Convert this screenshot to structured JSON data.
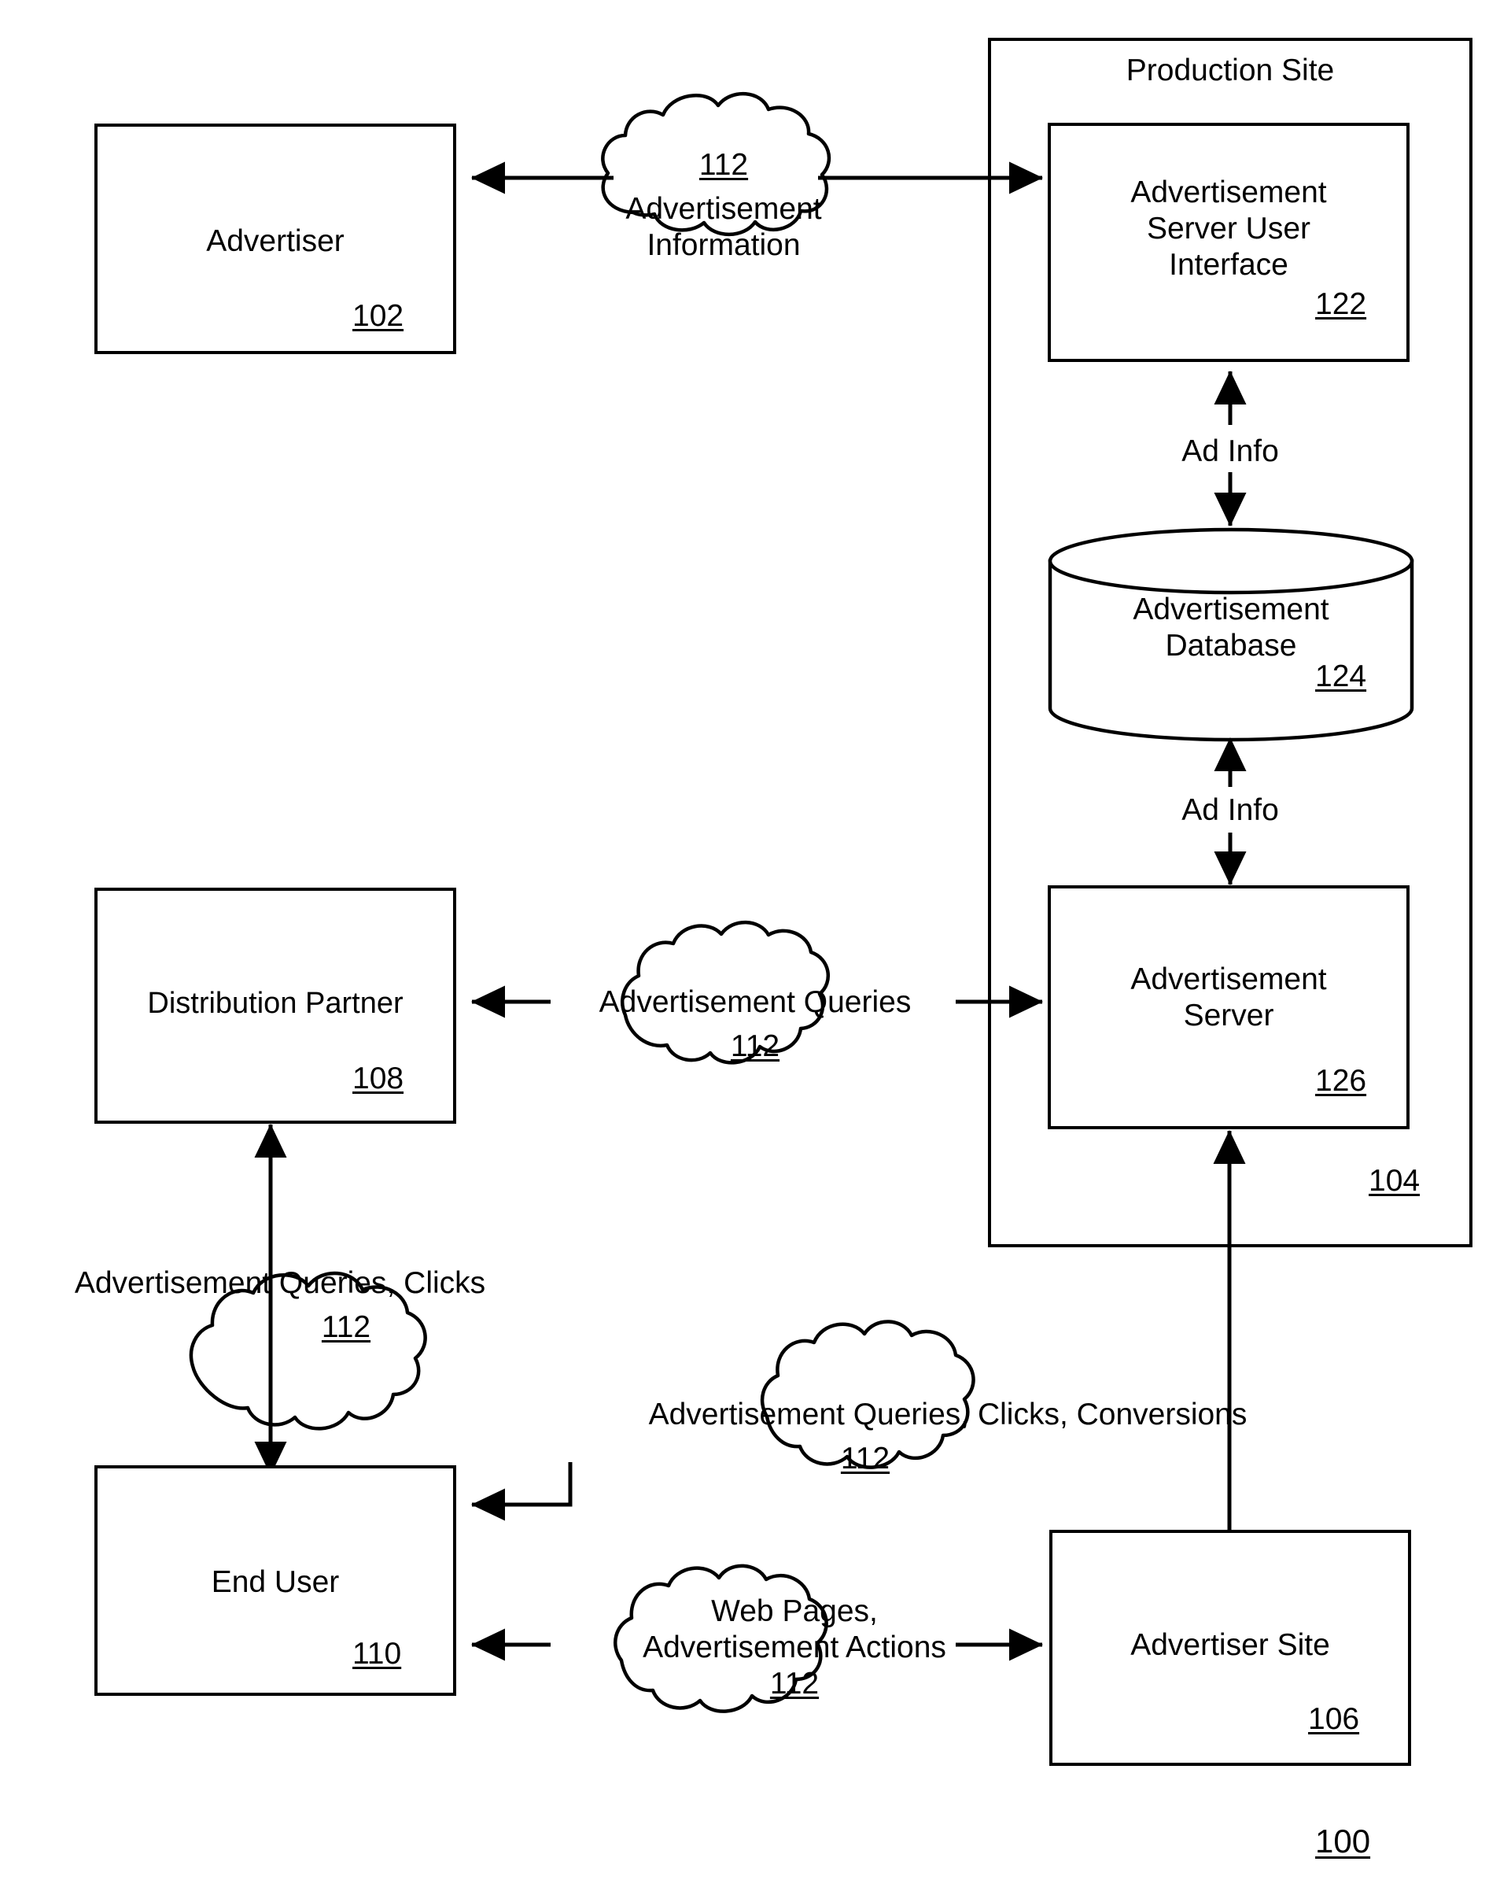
{
  "figure": {
    "number": "100",
    "type": "patent-block-diagram"
  },
  "nodes": {
    "advertiser": {
      "label": "Advertiser",
      "ref": "102"
    },
    "production_site": {
      "label": "Production Site",
      "ref": "104"
    },
    "ad_server_ui": {
      "label": "Advertisement\nServer User\nInterface",
      "ref": "122"
    },
    "ad_database": {
      "label": "Advertisement\nDatabase",
      "ref": "124"
    },
    "ad_server": {
      "label": "Advertisement\nServer",
      "ref": "126"
    },
    "distribution_partner": {
      "label": "Distribution Partner",
      "ref": "108"
    },
    "end_user": {
      "label": "End User",
      "ref": "110"
    },
    "advertiser_site": {
      "label": "Advertiser Site",
      "ref": "106"
    }
  },
  "clouds": {
    "ad_information": {
      "ref": "112",
      "line1": "Advertisement",
      "line2": "Information"
    },
    "ad_queries": {
      "label": "Advertisement Queries",
      "ref": "112"
    },
    "ad_queries_clicks": {
      "label": "Advertisement Queries, Clicks",
      "ref": "112"
    },
    "ad_queries_clicks_conversions": {
      "label": "Advertisement Queries, Clicks, Conversions",
      "ref": "112"
    },
    "web_pages_actions": {
      "line1": "Web Pages,",
      "line2": "Advertisement Actions",
      "ref": "112"
    }
  },
  "edge_labels": {
    "ui_to_db": "Ad Info",
    "db_to_server": "Ad Info"
  },
  "colors": {
    "stroke": "#000000",
    "background": "#ffffff"
  }
}
